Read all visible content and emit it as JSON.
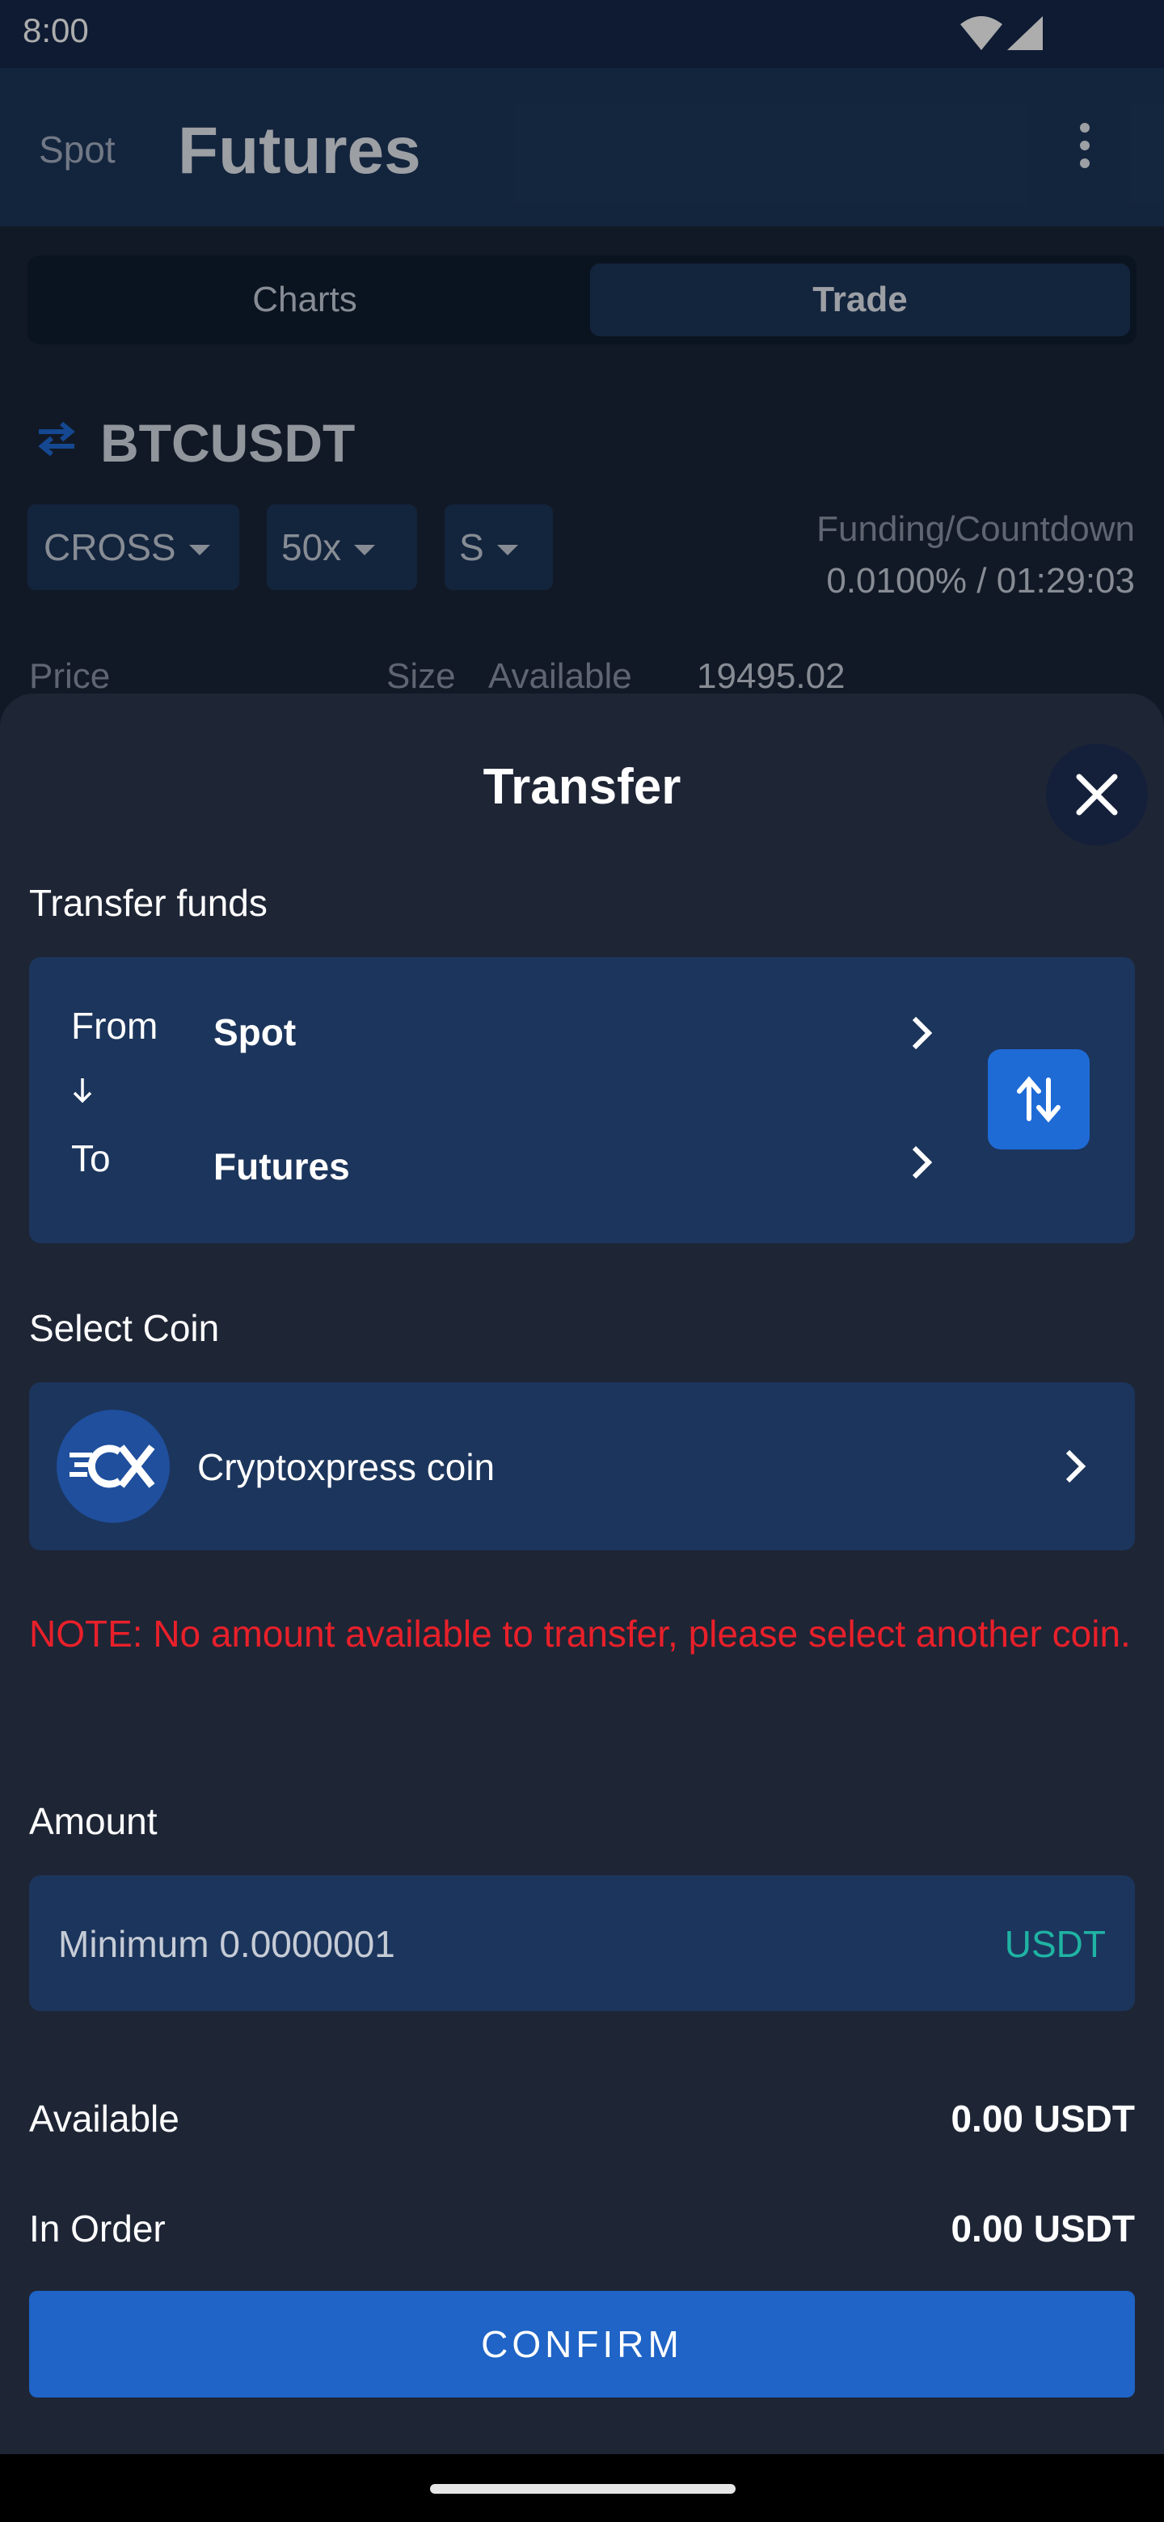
{
  "status_bar": {
    "time": "8:00",
    "icons": [
      "wifi-icon",
      "signal-icon"
    ]
  },
  "background_app": {
    "header": {
      "spot_label": "Spot",
      "title": "Futures",
      "menu_icon": "more-vertical-icon"
    },
    "tabs": [
      {
        "label": "Charts",
        "active": false
      },
      {
        "label": "Trade",
        "active": true
      }
    ],
    "pair": {
      "icon": "swap-arrows-icon",
      "symbol": "BTCUSDT"
    },
    "chips": {
      "margin_mode": "CROSS",
      "leverage": "50x",
      "side": "S"
    },
    "funding": {
      "label": "Funding/Countdown",
      "value": "0.0100% / 01:29:03"
    },
    "orderbook_headers": {
      "price": "Price",
      "size": "Size",
      "available": "Available",
      "last_price": "19495.02"
    }
  },
  "sheet": {
    "title": "Transfer",
    "close_icon": "close-icon",
    "transfer_section_label": "Transfer funds",
    "from_label": "From",
    "to_label": "To",
    "from_value": "Spot",
    "to_value": "Futures",
    "swap_icon": "swap-vertical-icon",
    "coin_section_label": "Select Coin",
    "coin": {
      "name": "Cryptoxpress coin",
      "logo": "cryptoxpress-logo"
    },
    "note": "NOTE: No amount available to transfer, please select another coin.",
    "amount_label": "Amount",
    "amount_placeholder": "Minimum 0.0000001",
    "amount_value": "",
    "amount_unit": "USDT",
    "available_label": "Available",
    "available_value": "0.00 USDT",
    "in_order_label": "In Order",
    "in_order_value": "0.00 USDT",
    "confirm_label": "CONFIRM"
  },
  "colors": {
    "accent": "#1f64c6",
    "sheet_bg": "#1e2535",
    "card_bg": "#1c355c",
    "error": "#e8202a",
    "unit": "#1fb3a3"
  }
}
